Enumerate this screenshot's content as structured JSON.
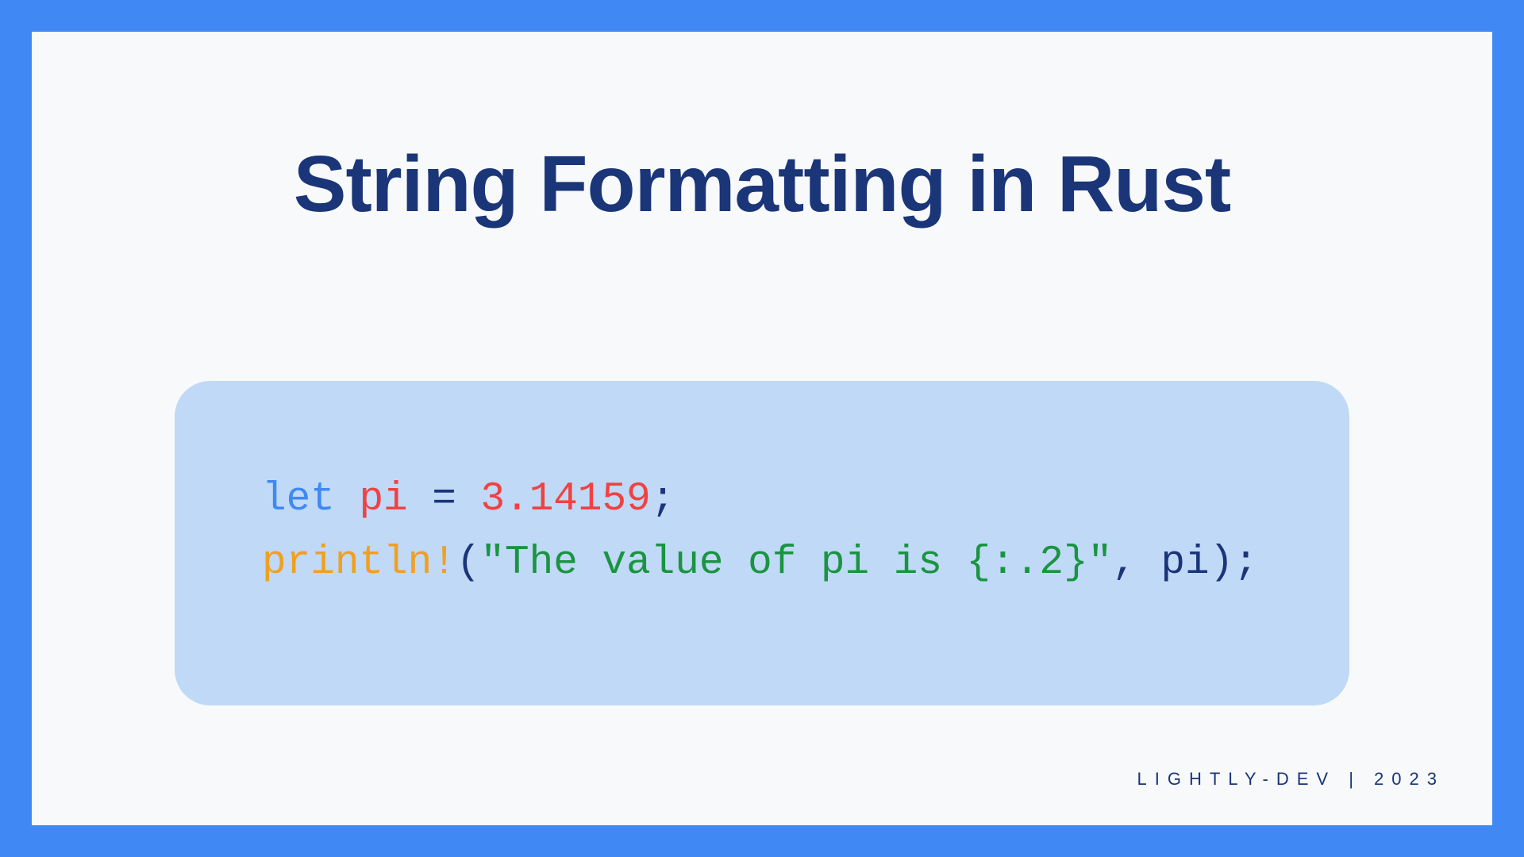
{
  "title": "String Formatting in Rust",
  "code": {
    "line1": {
      "keyword": "let",
      "sp1": " ",
      "var": "pi",
      "sp2": " ",
      "assign": "=",
      "sp3": " ",
      "num": "3.14159",
      "semi": ";"
    },
    "line2": {
      "macro": "println!",
      "lparen": "(",
      "str": "\"The value of pi is {:.2}\"",
      "comma": ",",
      "sp1": " ",
      "id": "pi",
      "rparen": ")",
      "semi": ";"
    }
  },
  "footer": "LIGHTLY-DEV | 2023"
}
